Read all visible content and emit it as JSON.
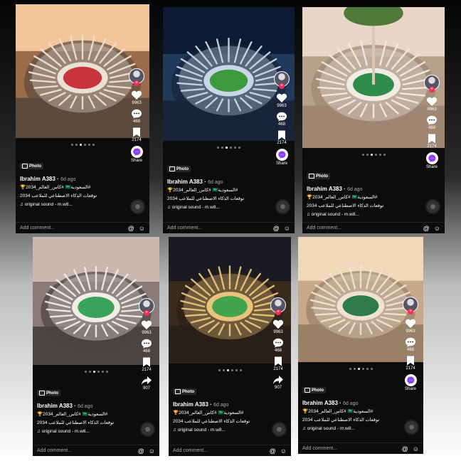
{
  "panels": [
    {
      "author": "Ibrahim A383",
      "ago": "6d ago",
      "badge": "Photo",
      "caption_line1": "#السعودية🇸🇦 #كاس_العالم_2034🏆",
      "caption_line2": "توقعات الذكاء الاصطناعي للملاعب 2034",
      "sound": "original sound - m.w8...",
      "likes": "9963",
      "comments": "468",
      "saves": "2174",
      "action_label": "Share",
      "add_comment": "Add comment...",
      "at": "@",
      "emoji": "☺",
      "theme": "warm"
    },
    {
      "author": "Ibrahim A383",
      "ago": "6d ago",
      "badge": "Photo",
      "caption_line1": "#السعودية🇸🇦 #كاس_العالم_2034🏆",
      "caption_line2": "توقعات الذكاء الاصطناعي للملاعب 2034",
      "sound": "original sound - m.w8...",
      "likes": "9963",
      "comments": "468",
      "saves": "2174",
      "action_label": "Share",
      "add_comment": "Add comment...",
      "at": "@",
      "emoji": "☺",
      "theme": "night"
    },
    {
      "author": "Ibrahim A383",
      "ago": "6d ago",
      "badge": "Photo",
      "caption_line1": "#السعودية🇸🇦 #كاس_العالم_2034🏆",
      "caption_line2": "توقعات الذكاء الاصطناعي للملاعب 2034",
      "sound": "original sound - m.w8...",
      "likes": "9963",
      "comments": "468",
      "saves": "2174",
      "action_label": "Share",
      "add_comment": "Add comment...",
      "at": "@",
      "emoji": "☺",
      "theme": "palm"
    },
    {
      "author": "Ibrahim A383",
      "ago": "6d ago",
      "badge": "Photo",
      "caption_line1": "#السعودية🇸🇦 #كاس_العالم_2034🏆",
      "caption_line2": "توقعات الذكاء الاصطناعي للملاعب 2034",
      "sound": "original sound - m.w8...",
      "likes": "9963",
      "comments": "468",
      "saves": "2174",
      "action_label": "907",
      "add_comment": "Add comment...",
      "at": "@",
      "emoji": "☺",
      "theme": "lotus"
    },
    {
      "author": "Ibrahim A383",
      "ago": "6d ago",
      "badge": "Photo",
      "caption_line1": "#السعودية🇸🇦 #كاس_العالم_2034🏆",
      "caption_line2": "توقعات الذكاء الاصطناعي للملاعب 2034",
      "sound": "original sound - m.w8...",
      "likes": "9963",
      "comments": "468",
      "saves": "2174",
      "action_label": "907",
      "add_comment": "Add comment...",
      "at": "@",
      "emoji": "☺",
      "theme": "gold"
    },
    {
      "author": "Ibrahim A383",
      "ago": "6d ago",
      "badge": "Photo",
      "caption_line1": "#السعودية🇸🇦 #كاس_العالم_2034🏆",
      "caption_line2": "توقعات الذكاء الاصطناعي للملاعب 2034",
      "sound": "original sound - m.w8...",
      "likes": "9963",
      "comments": "468",
      "saves": "2174",
      "action_label": "Share",
      "add_comment": "Add comment...",
      "at": "@",
      "emoji": "☺",
      "theme": "sand"
    }
  ],
  "colors": {
    "like": "#ffffff",
    "plus": "#fe2c55",
    "messenger": "#8a3cff"
  }
}
